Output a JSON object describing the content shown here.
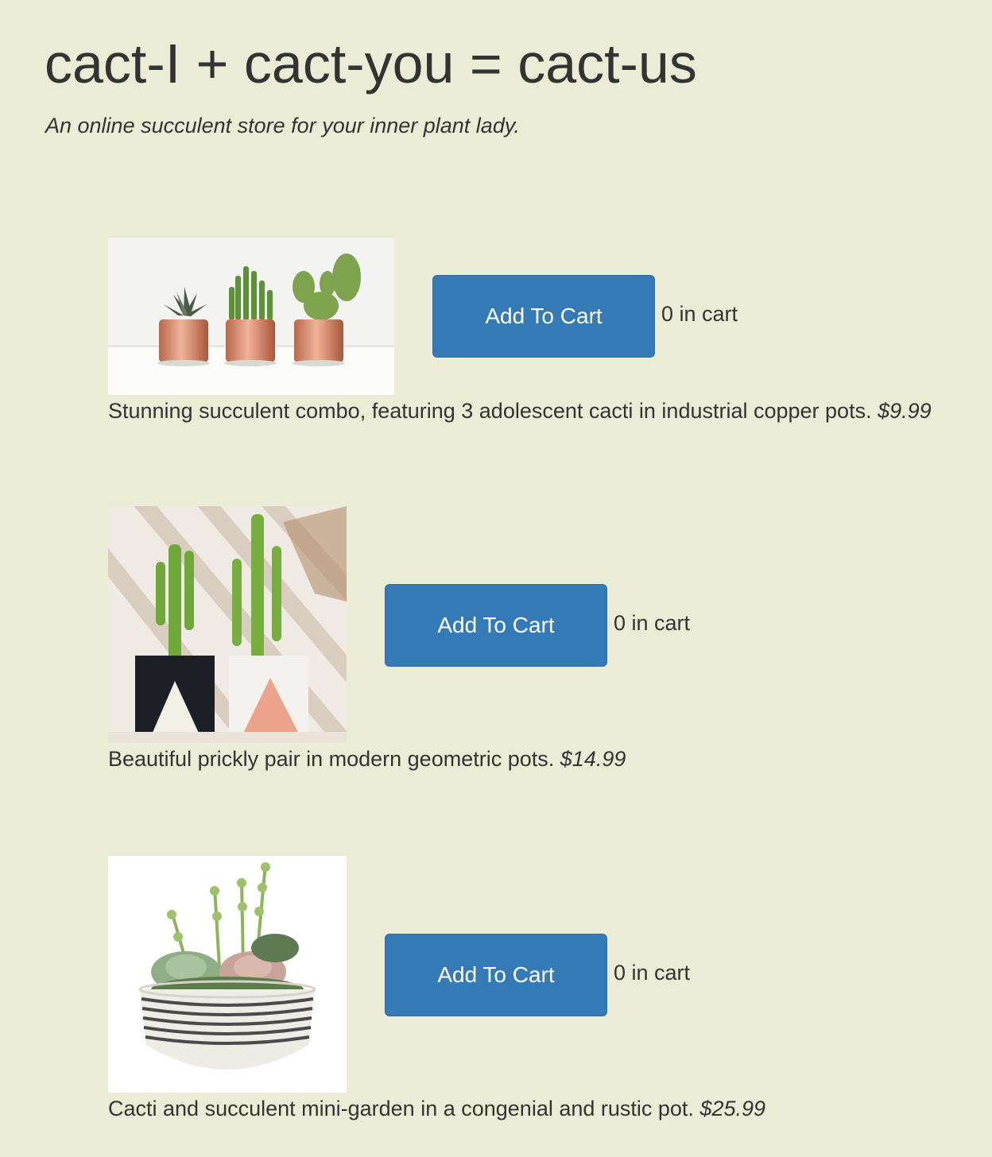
{
  "header": {
    "title": "cact-I + cact-you = cact-us",
    "tagline": "An online succulent store for your inner plant lady."
  },
  "products": [
    {
      "image": "three cacti in copper pots",
      "button_label": "Add To Cart",
      "cart_count": "0 in cart",
      "description": "Stunning succulent combo, featuring 3 adolescent cacti in industrial copper pots.",
      "price": "$9.99"
    },
    {
      "image": "two cacti in geometric pots",
      "button_label": "Add To Cart",
      "cart_count": "0 in cart",
      "description": "Beautiful prickly pair in modern geometric pots.",
      "price": "$14.99"
    },
    {
      "image": "succulent mini-garden in striped bowl",
      "button_label": "Add To Cart",
      "cart_count": "0 in cart",
      "description": "Cacti and succulent mini-garden in a congenial and rustic pot.",
      "price": "$25.99"
    }
  ],
  "colors": {
    "background": "#ebecd5",
    "button": "#337ab7",
    "text": "#333333"
  }
}
